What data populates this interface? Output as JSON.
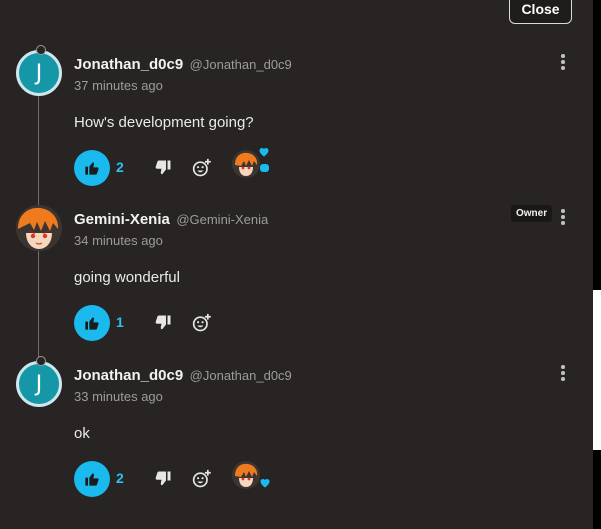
{
  "header": {
    "close_label": "Close"
  },
  "colors": {
    "accent": "#1ab9ee",
    "background": "#272423",
    "avatar_letter_bg": "#1597a8"
  },
  "comments": [
    {
      "avatar_letter": "J",
      "author": "Jonathan_d0c9",
      "handle": "@Jonathan_d0c9",
      "time": "37 minutes ago",
      "body": "How's development going?",
      "likes": "2"
    },
    {
      "author": "Gemini-Xenia",
      "handle": "@Gemini-Xenia",
      "time": "34 minutes ago",
      "body": "going wonderful",
      "likes": "1",
      "badge": "Owner"
    },
    {
      "avatar_letter": "J",
      "author": "Jonathan_d0c9",
      "handle": "@Jonathan_d0c9",
      "time": "33 minutes ago",
      "body": "ok",
      "likes": "2"
    }
  ],
  "icons": [
    "thumbs-up-icon",
    "thumbs-down-icon",
    "add-reaction-icon",
    "more-vertical-icon",
    "heart-icon"
  ]
}
